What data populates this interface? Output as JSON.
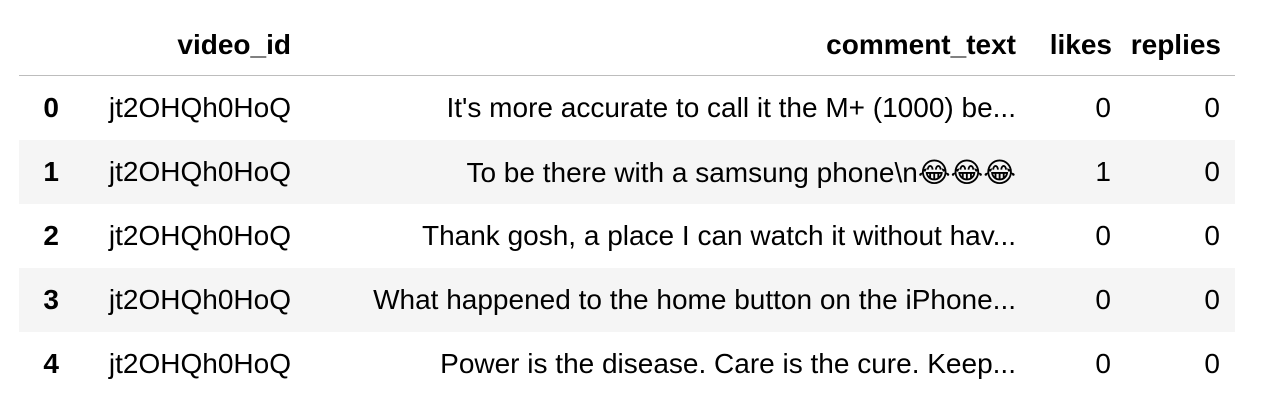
{
  "table": {
    "columns": [
      "",
      "video_id",
      "comment_text",
      "likes",
      "replies"
    ],
    "rows": [
      {
        "index": "0",
        "video_id": "jt2OHQh0HoQ",
        "comment_text": "It's more accurate to call it the M+ (1000) be...",
        "likes": "0",
        "replies": "0"
      },
      {
        "index": "1",
        "video_id": "jt2OHQh0HoQ",
        "comment_text": "To be there with a samsung phone\\n😂😂😂",
        "likes": "1",
        "replies": "0"
      },
      {
        "index": "2",
        "video_id": "jt2OHQh0HoQ",
        "comment_text": "Thank gosh, a place I can watch it without hav...",
        "likes": "0",
        "replies": "0"
      },
      {
        "index": "3",
        "video_id": "jt2OHQh0HoQ",
        "comment_text": "What happened to the home button on the iPhone...",
        "likes": "0",
        "replies": "0"
      },
      {
        "index": "4",
        "video_id": "jt2OHQh0HoQ",
        "comment_text": "Power is the disease.  Care is the cure.  Keep...",
        "likes": "0",
        "replies": "0"
      }
    ]
  }
}
